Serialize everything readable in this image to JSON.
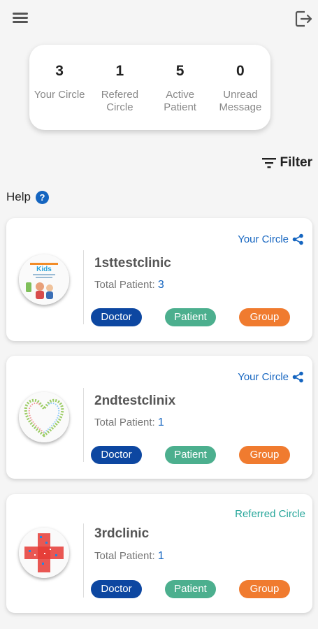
{
  "stats": [
    {
      "value": "3",
      "label": "Your Circle"
    },
    {
      "value": "1",
      "label": "Refered\nCircle"
    },
    {
      "value": "5",
      "label": "Active\nPatient"
    },
    {
      "value": "0",
      "label": "Unread\nMessage"
    }
  ],
  "filter": {
    "label": "Filter"
  },
  "help": {
    "label": "Help",
    "icon_glyph": "?"
  },
  "cards": [
    {
      "tag": "Your Circle",
      "name": "1sttestclinic",
      "patient_label": "Total Patient:",
      "patient_count": "3",
      "logo_text": "Kids",
      "buttons": {
        "doctor": "Doctor",
        "patient": "Patient",
        "group": "Group"
      }
    },
    {
      "tag": "Your Circle",
      "name": "2ndtestclinix",
      "patient_label": "Total Patient:",
      "patient_count": "1",
      "buttons": {
        "doctor": "Doctor",
        "patient": "Patient",
        "group": "Group"
      }
    },
    {
      "tag": "Referred Circle",
      "name": "3rdclinic",
      "patient_label": "Total Patient:",
      "patient_count": "1",
      "buttons": {
        "doctor": "Doctor",
        "patient": "Patient",
        "group": "Group"
      }
    }
  ],
  "colors": {
    "primary_blue": "#1565c0",
    "doctor": "#0d47a1",
    "patient": "#4caf8e",
    "group": "#f07b2f",
    "referred": "#26a69a"
  }
}
